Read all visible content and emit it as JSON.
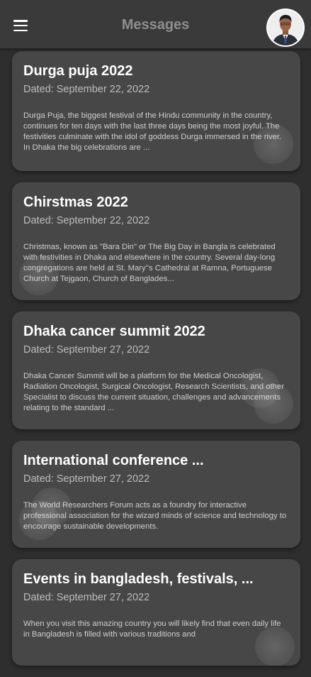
{
  "header": {
    "title": "Messages",
    "menu_icon": "hamburger-menu-icon",
    "avatar": "profile-avatar"
  },
  "messages": [
    {
      "title": "Durga puja 2022",
      "date": "Dated: September 22, 2022",
      "body": "Durga Puja, the biggest festival of the Hindu community in the country, continues for ten days with the last three days being the most joyful. The festivities culminate with the idol of goddess Durga immersed in the river. In Dhaka the big celebrations are ..."
    },
    {
      "title": "Chirstmas 2022",
      "date": "Dated: September 22, 2022",
      "body": "Christmas, known as \"Bara Din\" or The Big Day in Bangla is celebrated with festivities in Dhaka and elsewhere in the country. Several day-long congregations are held at St. Mary''s Cathedral at Ramna, Portuguese Church at Tejgaon, Church of Banglades..."
    },
    {
      "title": "Dhaka cancer summit 2022",
      "date": "Dated: September 27, 2022",
      "body": "Dhaka Cancer Summit will be a platform for the Medical Oncologist, Radiation Oncologist, Surgical Oncologist, Research Scientists, and other Specialist to discuss the current situation, challenges and advancements relating to the standard ..."
    },
    {
      "title": "International conference ...",
      "date": "Dated: September 27, 2022",
      "body": "The World Researchers Forum acts as a foundry for interactive professional association for the wizard minds of science and technology to encourage sustainable developments."
    },
    {
      "title": "Events in bangladesh, festivals, ...",
      "date": "Dated: September 27, 2022",
      "body": "When you visit this amazing country you will likely find that even daily life in Bangladesh is filled with various traditions and"
    }
  ]
}
